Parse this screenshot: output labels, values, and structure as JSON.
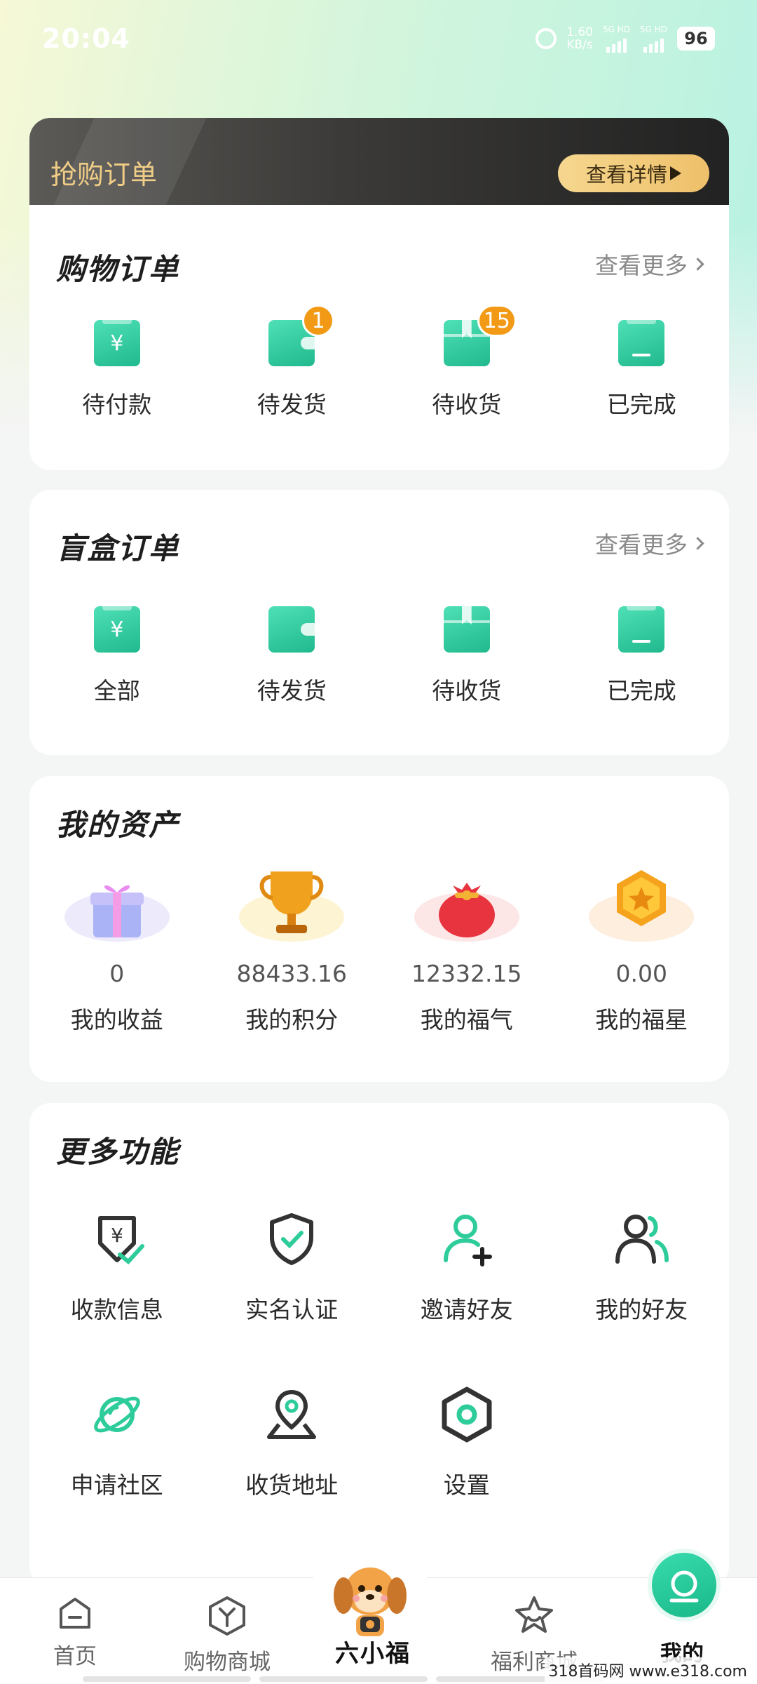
{
  "status_bar": {
    "time": "20:04",
    "net_speed_value": "1.60",
    "net_speed_unit": "KB/s",
    "sim1": "5G HD",
    "sim2": "5G HD",
    "battery": "96"
  },
  "flash_sale": {
    "title": "抢购订单",
    "detail_button": "查看详情"
  },
  "shopping_orders": {
    "title": "购物订单",
    "more": "查看更多",
    "items": [
      {
        "label": "待付款",
        "icon": "yen-bag-icon",
        "badge": ""
      },
      {
        "label": "待发货",
        "icon": "wallet-icon",
        "badge": "1"
      },
      {
        "label": "待收货",
        "icon": "package-icon",
        "badge": "15"
      },
      {
        "label": "已完成",
        "icon": "bag-complete-icon",
        "badge": ""
      }
    ]
  },
  "blind_box_orders": {
    "title": "盲盒订单",
    "more": "查看更多",
    "items": [
      {
        "label": "全部",
        "icon": "yen-bag-icon"
      },
      {
        "label": "待发货",
        "icon": "wallet-icon"
      },
      {
        "label": "待收货",
        "icon": "package-icon"
      },
      {
        "label": "已完成",
        "icon": "bag-complete-icon"
      }
    ]
  },
  "assets": {
    "title": "我的资产",
    "items": [
      {
        "value": "0",
        "label": "我的收益",
        "icon": "gift-box-icon",
        "plate_color": "#eceafb"
      },
      {
        "value": "88433.16",
        "label": "我的积分",
        "icon": "trophy-icon",
        "plate_color": "#fdf4d3"
      },
      {
        "value": "12332.15",
        "label": "我的福气",
        "icon": "lucky-bag-icon",
        "plate_color": "#fde6e6"
      },
      {
        "value": "0.00",
        "label": "我的福星",
        "icon": "star-coin-icon",
        "plate_color": "#fdeede"
      }
    ]
  },
  "more_functions": {
    "title": "更多功能",
    "items": [
      {
        "label": "收款信息",
        "icon": "payment-info-icon"
      },
      {
        "label": "实名认证",
        "icon": "verified-shield-icon"
      },
      {
        "label": "邀请好友",
        "icon": "invite-friend-icon"
      },
      {
        "label": "我的好友",
        "icon": "friends-icon"
      },
      {
        "label": "申请社区",
        "icon": "planet-icon"
      },
      {
        "label": "收货地址",
        "icon": "location-pin-icon"
      },
      {
        "label": "设置",
        "icon": "settings-hexagon-icon"
      }
    ]
  },
  "bottom_nav": {
    "items": [
      {
        "label": "首页",
        "icon": "home-icon"
      },
      {
        "label": "购物商城",
        "icon": "shop-icon"
      },
      {
        "label": "六小福",
        "icon": "mascot-icon"
      },
      {
        "label": "福利商城",
        "icon": "welfare-star-icon"
      },
      {
        "label": "我的",
        "icon": "profile-icon"
      }
    ],
    "active": "我的"
  },
  "watermark": "318首码网 www.e318.com",
  "colors": {
    "accent": "#23c494",
    "badge": "#f29a16",
    "banner_gold": "#f0cd86"
  }
}
